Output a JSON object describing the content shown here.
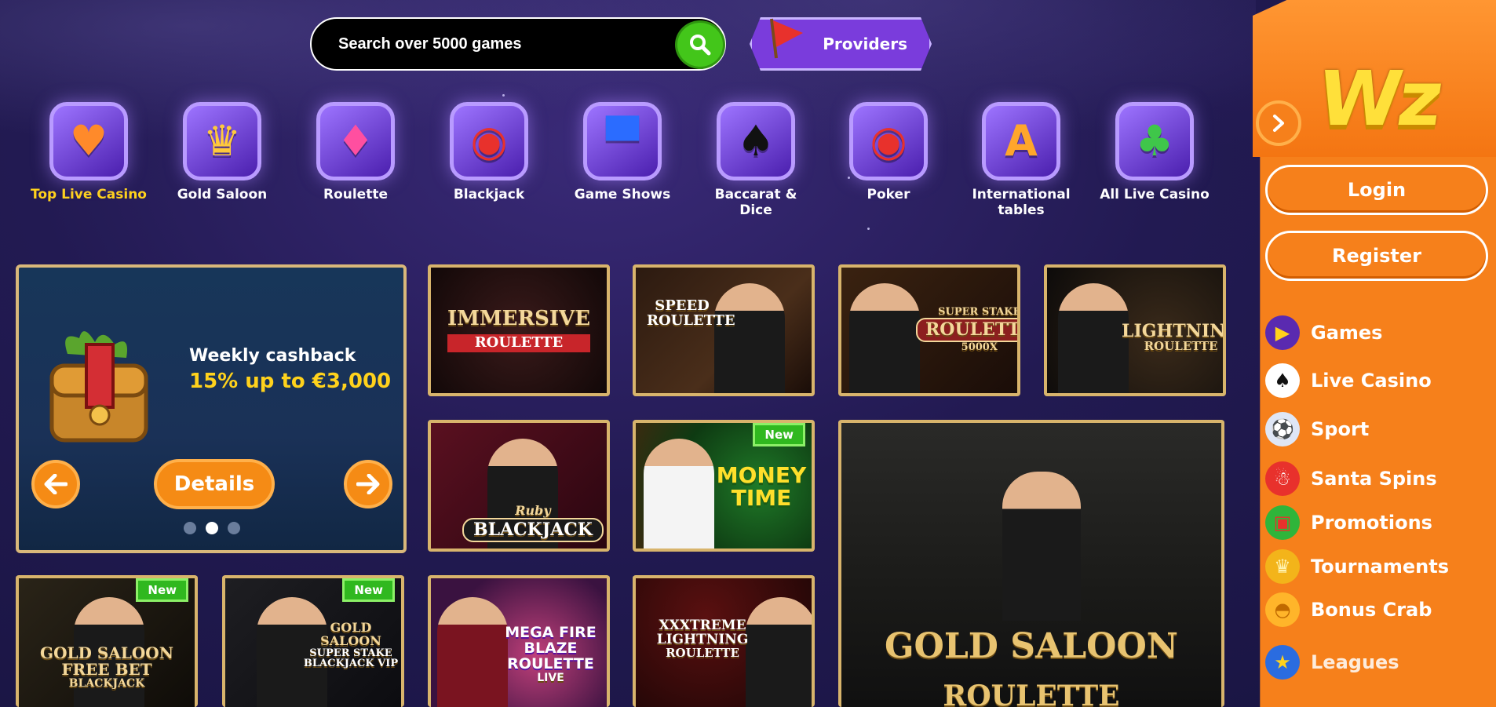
{
  "search": {
    "placeholder": "Search over 5000 games"
  },
  "providers": {
    "label": "Providers"
  },
  "categories": [
    {
      "label": "Top Live Casino",
      "icon": "heart-icon",
      "active": true
    },
    {
      "label": "Gold Saloon",
      "icon": "crown-icon"
    },
    {
      "label": "Roulette",
      "icon": "diamond-icon"
    },
    {
      "label": "Blackjack",
      "icon": "poker-chip-icon"
    },
    {
      "label": "Game Shows",
      "icon": "top-hat-icon"
    },
    {
      "label": "Baccarat & Dice",
      "icon": "spade-card-icon"
    },
    {
      "label": "Poker",
      "icon": "poker-chip-icon"
    },
    {
      "label": "International tables",
      "icon": "language-icon"
    },
    {
      "label": "All Live Casino",
      "icon": "club-icon"
    }
  ],
  "promo": {
    "title": "Weekly cashback",
    "subtitle": "15% up to €3,000",
    "details_label": "Details",
    "slide_count": 3,
    "active_slide": 2
  },
  "games": [
    {
      "title": "IMMERSIVE",
      "subtitle": "ROULETTE",
      "badge": ""
    },
    {
      "title": "SPEED ROULETTE",
      "subtitle": "",
      "badge": ""
    },
    {
      "title": "ROULETTE",
      "subtitle": "SUPER STAKE",
      "extra": "5000X",
      "badge": ""
    },
    {
      "title": "LIGHTNING",
      "subtitle": "ROULETTE",
      "badge": ""
    },
    {
      "title": "BLACKJACK",
      "subtitle": "Ruby",
      "badge": ""
    },
    {
      "title": "MONEY TIME",
      "subtitle": "",
      "badge": "New"
    },
    {
      "title": "GOLD SALOON",
      "subtitle": "ROULETTE",
      "badge": ""
    },
    {
      "title": "GOLD SALOON FREE BET",
      "subtitle": "BLACKJACK",
      "badge": "New"
    },
    {
      "title": "GOLD SALOON",
      "subtitle": "SUPER STAKE BLACKJACK VIP",
      "badge": "New"
    },
    {
      "title": "MEGA FIRE BLAZE ROULETTE",
      "subtitle": "LIVE",
      "badge": ""
    },
    {
      "title": "XXXTREME LIGHTNING",
      "subtitle": "ROULETTE",
      "badge": ""
    }
  ],
  "sidebar": {
    "logo": "Wz",
    "login_label": "Login",
    "register_label": "Register",
    "menu": [
      {
        "label": "Games",
        "icon": "play-icon"
      },
      {
        "label": "Live Casino",
        "icon": "card-icon"
      },
      {
        "label": "Sport",
        "icon": "soccer-ball-icon"
      },
      {
        "label": "Santa Spins",
        "icon": "santa-icon"
      },
      {
        "label": "Promotions",
        "icon": "gift-icon"
      },
      {
        "label": "Tournaments",
        "icon": "trophy-icon"
      },
      {
        "label": "Bonus Crab",
        "icon": "crab-icon"
      },
      {
        "label": "Leagues",
        "icon": "leagues-icon"
      }
    ]
  },
  "colors": {
    "accent": "#f6801b",
    "highlight": "#ffd21c",
    "new_badge": "#30b81f",
    "background": "#221a52"
  }
}
